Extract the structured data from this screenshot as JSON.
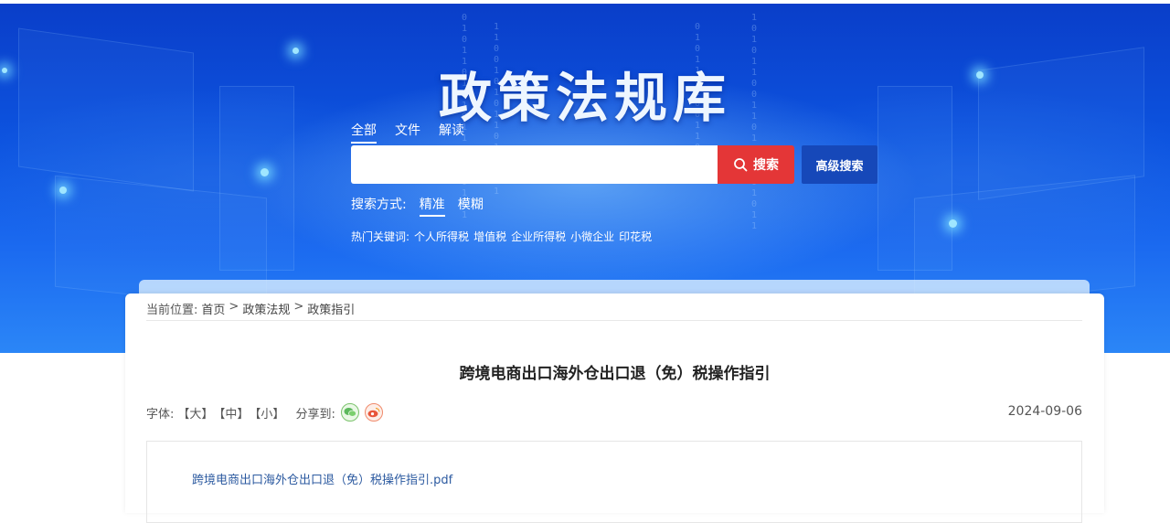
{
  "banner": {
    "title": "政策法规库"
  },
  "search": {
    "tabs": [
      {
        "label": "全部",
        "active": true
      },
      {
        "label": "文件",
        "active": false
      },
      {
        "label": "解读",
        "active": false
      }
    ],
    "input_value": "",
    "placeholder": "",
    "button_label": "搜索",
    "advanced_label": "高级搜索",
    "mode_label": "搜索方式:",
    "modes": [
      {
        "label": "精准",
        "active": true
      },
      {
        "label": "模糊",
        "active": false
      }
    ],
    "hot_label": "热门关键词:",
    "hot_keywords": [
      "个人所得税",
      "增值税",
      "企业所得税",
      "小微企业",
      "印花税"
    ]
  },
  "breadcrumb": {
    "prefix": "当前位置:",
    "items": [
      "首页",
      "政策法规",
      "政策指引"
    ],
    "separator": ">"
  },
  "article": {
    "title": "跨境电商出口海外仓出口退（免）税操作指引",
    "font_label": "字体:",
    "font_sizes": [
      "【大】",
      "【中】",
      "【小】"
    ],
    "share_label": "分享到:",
    "share_icons": [
      "wechat-icon",
      "weibo-icon"
    ],
    "date": "2024-09-06",
    "attachment": "跨境电商出口海外仓出口退（免）税操作指引.pdf"
  },
  "colors": {
    "search_button": "#e43637",
    "advanced_button": "#1648b9",
    "banner": "#0d54e0",
    "link": "#2c5aa0"
  }
}
